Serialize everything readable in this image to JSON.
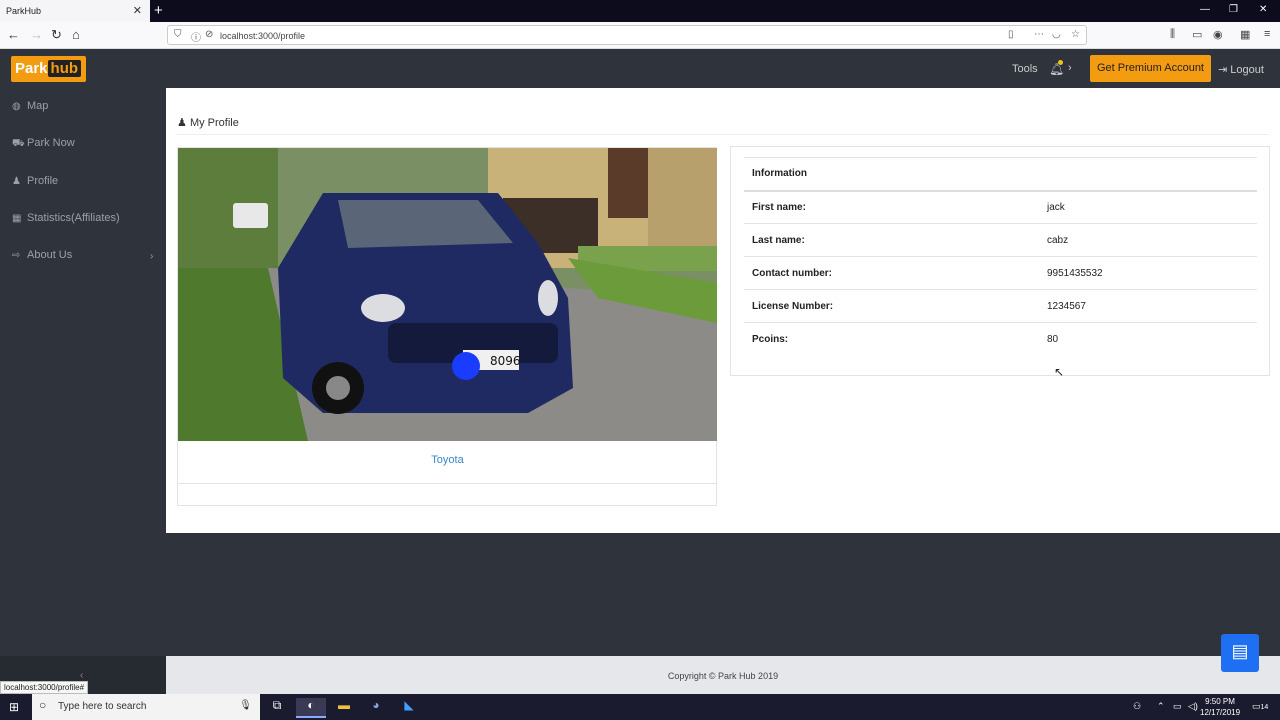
{
  "browser": {
    "tab_title": "ParkHub",
    "url": "localhost:3000/profile",
    "status_url": "localhost:3000/profile#"
  },
  "header": {
    "logo_park": "Park",
    "logo_hub": "hub",
    "tools_label": "Tools",
    "premium_label": "Get Premium Account",
    "logout_label": "Logout"
  },
  "sidebar": {
    "items": [
      {
        "label": "Map",
        "icon": "globe-icon"
      },
      {
        "label": "Park Now",
        "icon": "car-icon"
      },
      {
        "label": "Profile",
        "icon": "user-icon"
      },
      {
        "label": "Statistics(Affiliates)",
        "icon": "calendar-icon"
      },
      {
        "label": "About Us",
        "icon": "sign-in-icon"
      }
    ]
  },
  "main": {
    "page_title": "My Profile",
    "car_name": "Toyota",
    "info_header": "Information",
    "rows": [
      {
        "key": "First name:",
        "value": "jack"
      },
      {
        "key": "Last name:",
        "value": "cabz"
      },
      {
        "key": "Contact number:",
        "value": "9951435532"
      },
      {
        "key": "License Number:",
        "value": "1234567"
      },
      {
        "key": "Pcoins:",
        "value": "80"
      }
    ]
  },
  "footer": {
    "copyright": "Copyright © Park Hub 2019"
  },
  "taskbar": {
    "search_placeholder": "Type here to search",
    "time": "9:50 PM",
    "date": "12/17/2019",
    "notif_count": "14"
  },
  "colors": {
    "accent": "#f39c12",
    "dark": "#2f343c",
    "link": "#3a87c8",
    "chat": "#1e6ff1"
  }
}
